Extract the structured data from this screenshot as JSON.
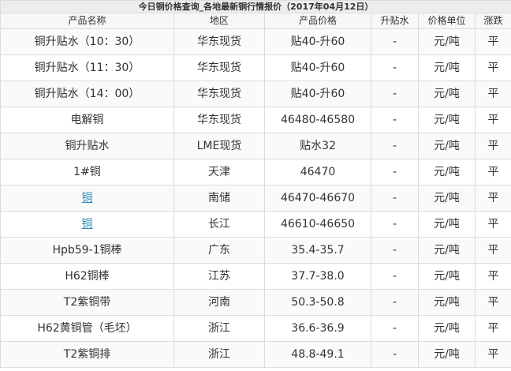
{
  "title": "今日铜价格查询_各地最新铜行情报价（2017年04月12日）",
  "headers": [
    "产品名称",
    "地区",
    "产品价格",
    "升贴水",
    "价格单位",
    "涨跌"
  ],
  "rows": [
    {
      "name": "铜升贴水（10：30）",
      "region": "华东现货",
      "price": "贴40-升60",
      "premium": "-",
      "unit": "元/吨",
      "change": "平",
      "link": false
    },
    {
      "name": "铜升贴水（11：30）",
      "region": "华东现货",
      "price": "贴40-升60",
      "premium": "-",
      "unit": "元/吨",
      "change": "平",
      "link": false
    },
    {
      "name": "铜升贴水（14：00）",
      "region": "华东现货",
      "price": "贴40-升60",
      "premium": "-",
      "unit": "元/吨",
      "change": "平",
      "link": false
    },
    {
      "name": "电解铜",
      "region": "华东现货",
      "price": "46480-46580",
      "premium": "-",
      "unit": "元/吨",
      "change": "平",
      "link": false
    },
    {
      "name": "铜升贴水",
      "region": "LME现货",
      "price": "贴水32",
      "premium": "-",
      "unit": "元/吨",
      "change": "平",
      "link": false
    },
    {
      "name": "1#铜",
      "region": "天津",
      "price": "46470",
      "premium": "-",
      "unit": "元/吨",
      "change": "平",
      "link": false
    },
    {
      "name": "铜",
      "region": "南储",
      "price": "46470-46670",
      "premium": "-",
      "unit": "元/吨",
      "change": "平",
      "link": true
    },
    {
      "name": "铜",
      "region": "长江",
      "price": "46610-46650",
      "premium": "-",
      "unit": "元/吨",
      "change": "平",
      "link": true
    },
    {
      "name": "Hpb59-1铜棒",
      "region": "广东",
      "price": "35.4-35.7",
      "premium": "-",
      "unit": "元/吨",
      "change": "平",
      "link": false
    },
    {
      "name": "H62铜棒",
      "region": "江苏",
      "price": "37.7-38.0",
      "premium": "-",
      "unit": "元/吨",
      "change": "平",
      "link": false
    },
    {
      "name": "T2紫铜带",
      "region": "河南",
      "price": "50.3-50.8",
      "premium": "-",
      "unit": "元/吨",
      "change": "平",
      "link": false
    },
    {
      "name": "H62黄铜管（毛坯）",
      "region": "浙江",
      "price": "36.6-36.9",
      "premium": "-",
      "unit": "元/吨",
      "change": "平",
      "link": false
    },
    {
      "name": "T2紫铜排",
      "region": "浙江",
      "price": "48.8-49.1",
      "premium": "-",
      "unit": "元/吨",
      "change": "平",
      "link": false
    }
  ],
  "colors": {
    "link": "#2e8bb8",
    "title_bg": "#ededed",
    "border": "#dcdcdc"
  }
}
